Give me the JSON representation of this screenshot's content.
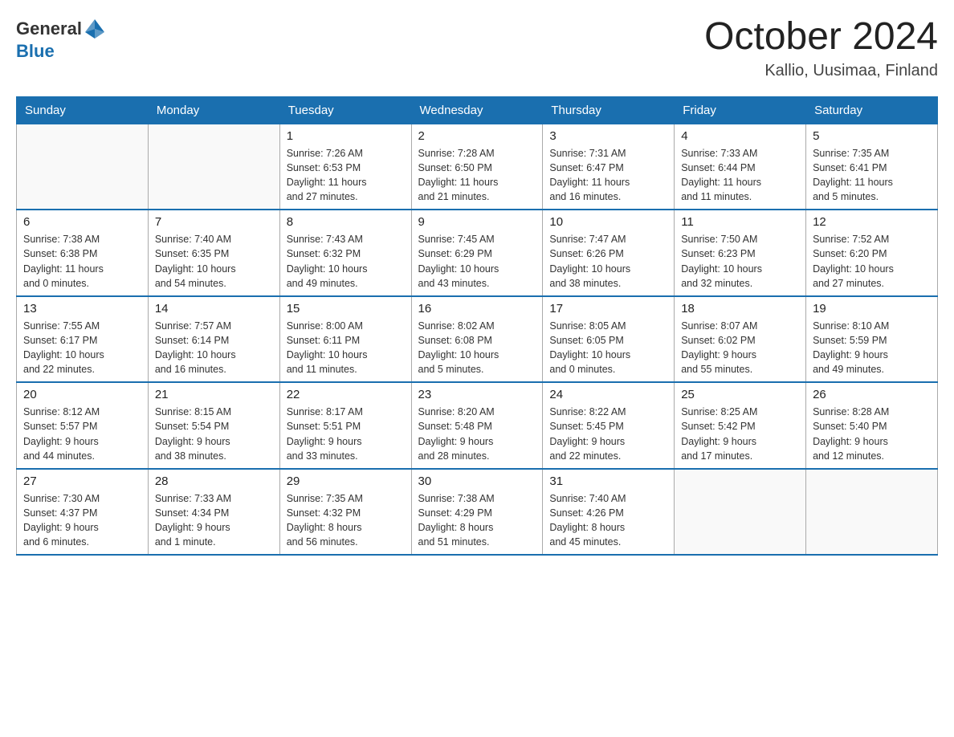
{
  "header": {
    "logo_general": "General",
    "logo_blue": "Blue",
    "title": "October 2024",
    "subtitle": "Kallio, Uusimaa, Finland"
  },
  "days_of_week": [
    "Sunday",
    "Monday",
    "Tuesday",
    "Wednesday",
    "Thursday",
    "Friday",
    "Saturday"
  ],
  "weeks": [
    [
      {
        "day": "",
        "info": ""
      },
      {
        "day": "",
        "info": ""
      },
      {
        "day": "1",
        "info": "Sunrise: 7:26 AM\nSunset: 6:53 PM\nDaylight: 11 hours\nand 27 minutes."
      },
      {
        "day": "2",
        "info": "Sunrise: 7:28 AM\nSunset: 6:50 PM\nDaylight: 11 hours\nand 21 minutes."
      },
      {
        "day": "3",
        "info": "Sunrise: 7:31 AM\nSunset: 6:47 PM\nDaylight: 11 hours\nand 16 minutes."
      },
      {
        "day": "4",
        "info": "Sunrise: 7:33 AM\nSunset: 6:44 PM\nDaylight: 11 hours\nand 11 minutes."
      },
      {
        "day": "5",
        "info": "Sunrise: 7:35 AM\nSunset: 6:41 PM\nDaylight: 11 hours\nand 5 minutes."
      }
    ],
    [
      {
        "day": "6",
        "info": "Sunrise: 7:38 AM\nSunset: 6:38 PM\nDaylight: 11 hours\nand 0 minutes."
      },
      {
        "day": "7",
        "info": "Sunrise: 7:40 AM\nSunset: 6:35 PM\nDaylight: 10 hours\nand 54 minutes."
      },
      {
        "day": "8",
        "info": "Sunrise: 7:43 AM\nSunset: 6:32 PM\nDaylight: 10 hours\nand 49 minutes."
      },
      {
        "day": "9",
        "info": "Sunrise: 7:45 AM\nSunset: 6:29 PM\nDaylight: 10 hours\nand 43 minutes."
      },
      {
        "day": "10",
        "info": "Sunrise: 7:47 AM\nSunset: 6:26 PM\nDaylight: 10 hours\nand 38 minutes."
      },
      {
        "day": "11",
        "info": "Sunrise: 7:50 AM\nSunset: 6:23 PM\nDaylight: 10 hours\nand 32 minutes."
      },
      {
        "day": "12",
        "info": "Sunrise: 7:52 AM\nSunset: 6:20 PM\nDaylight: 10 hours\nand 27 minutes."
      }
    ],
    [
      {
        "day": "13",
        "info": "Sunrise: 7:55 AM\nSunset: 6:17 PM\nDaylight: 10 hours\nand 22 minutes."
      },
      {
        "day": "14",
        "info": "Sunrise: 7:57 AM\nSunset: 6:14 PM\nDaylight: 10 hours\nand 16 minutes."
      },
      {
        "day": "15",
        "info": "Sunrise: 8:00 AM\nSunset: 6:11 PM\nDaylight: 10 hours\nand 11 minutes."
      },
      {
        "day": "16",
        "info": "Sunrise: 8:02 AM\nSunset: 6:08 PM\nDaylight: 10 hours\nand 5 minutes."
      },
      {
        "day": "17",
        "info": "Sunrise: 8:05 AM\nSunset: 6:05 PM\nDaylight: 10 hours\nand 0 minutes."
      },
      {
        "day": "18",
        "info": "Sunrise: 8:07 AM\nSunset: 6:02 PM\nDaylight: 9 hours\nand 55 minutes."
      },
      {
        "day": "19",
        "info": "Sunrise: 8:10 AM\nSunset: 5:59 PM\nDaylight: 9 hours\nand 49 minutes."
      }
    ],
    [
      {
        "day": "20",
        "info": "Sunrise: 8:12 AM\nSunset: 5:57 PM\nDaylight: 9 hours\nand 44 minutes."
      },
      {
        "day": "21",
        "info": "Sunrise: 8:15 AM\nSunset: 5:54 PM\nDaylight: 9 hours\nand 38 minutes."
      },
      {
        "day": "22",
        "info": "Sunrise: 8:17 AM\nSunset: 5:51 PM\nDaylight: 9 hours\nand 33 minutes."
      },
      {
        "day": "23",
        "info": "Sunrise: 8:20 AM\nSunset: 5:48 PM\nDaylight: 9 hours\nand 28 minutes."
      },
      {
        "day": "24",
        "info": "Sunrise: 8:22 AM\nSunset: 5:45 PM\nDaylight: 9 hours\nand 22 minutes."
      },
      {
        "day": "25",
        "info": "Sunrise: 8:25 AM\nSunset: 5:42 PM\nDaylight: 9 hours\nand 17 minutes."
      },
      {
        "day": "26",
        "info": "Sunrise: 8:28 AM\nSunset: 5:40 PM\nDaylight: 9 hours\nand 12 minutes."
      }
    ],
    [
      {
        "day": "27",
        "info": "Sunrise: 7:30 AM\nSunset: 4:37 PM\nDaylight: 9 hours\nand 6 minutes."
      },
      {
        "day": "28",
        "info": "Sunrise: 7:33 AM\nSunset: 4:34 PM\nDaylight: 9 hours\nand 1 minute."
      },
      {
        "day": "29",
        "info": "Sunrise: 7:35 AM\nSunset: 4:32 PM\nDaylight: 8 hours\nand 56 minutes."
      },
      {
        "day": "30",
        "info": "Sunrise: 7:38 AM\nSunset: 4:29 PM\nDaylight: 8 hours\nand 51 minutes."
      },
      {
        "day": "31",
        "info": "Sunrise: 7:40 AM\nSunset: 4:26 PM\nDaylight: 8 hours\nand 45 minutes."
      },
      {
        "day": "",
        "info": ""
      },
      {
        "day": "",
        "info": ""
      }
    ]
  ]
}
